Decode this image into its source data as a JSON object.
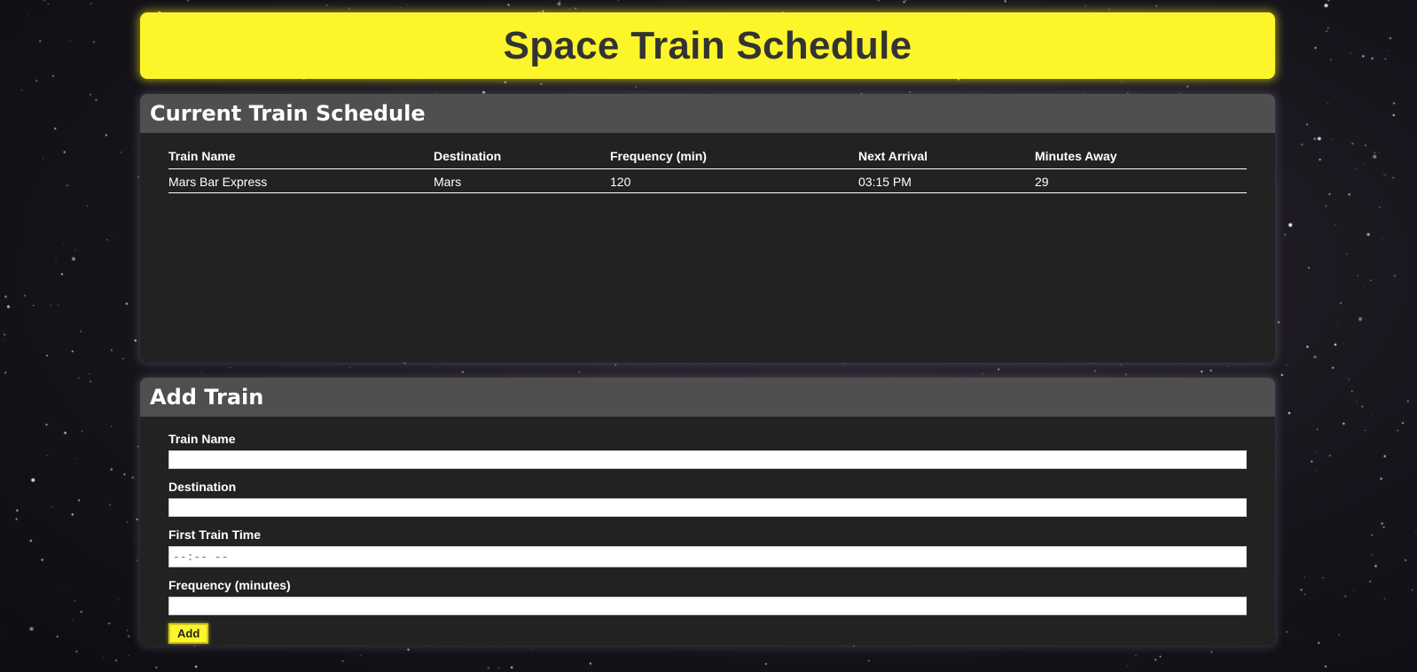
{
  "page": {
    "title": "Space Train Schedule"
  },
  "schedule": {
    "heading": "Current Train Schedule",
    "columns": [
      "Train Name",
      "Destination",
      "Frequency (min)",
      "Next Arrival",
      "Minutes Away"
    ],
    "rows": [
      [
        "Mars Bar Express",
        "Mars",
        "120",
        "03:15 PM",
        "29"
      ]
    ]
  },
  "add_train": {
    "heading": "Add Train",
    "fields": {
      "train_name": {
        "label": "Train Name",
        "value": ""
      },
      "destination": {
        "label": "Destination",
        "value": ""
      },
      "first_time": {
        "label": "First Train Time",
        "placeholder": "--:-- --"
      },
      "frequency": {
        "label": "Frequency (minutes)",
        "value": ""
      }
    },
    "submit_label": "Add"
  },
  "colors": {
    "accent": "#fbf52a",
    "panel": "#222222",
    "panel_header": "#4f4f4f",
    "title_text": "#333333"
  }
}
